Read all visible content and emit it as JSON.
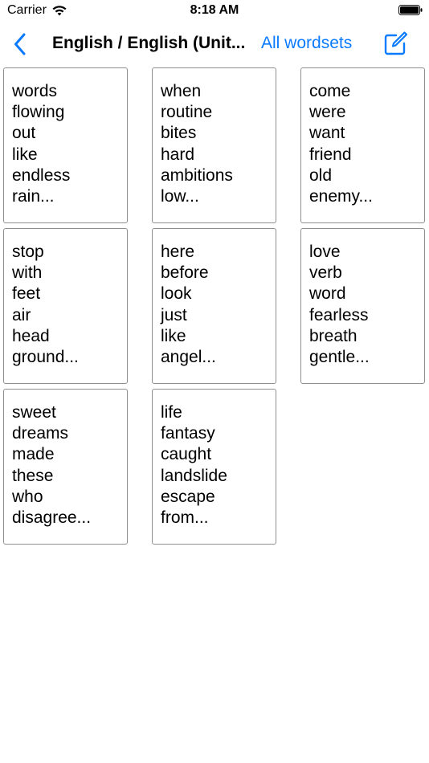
{
  "status_bar": {
    "carrier": "Carrier",
    "time": "8:18 AM"
  },
  "nav": {
    "title": "English / English (Unit...",
    "all_wordsets_label": "All wordsets",
    "accent_color": "#0a7aff"
  },
  "wordsets": [
    {
      "lines": [
        "words",
        "flowing",
        "out",
        "like",
        "endless",
        "rain..."
      ]
    },
    {
      "lines": [
        "when",
        "routine",
        "bites",
        "hard",
        "ambitions",
        "low..."
      ]
    },
    {
      "lines": [
        "come",
        "were",
        "want",
        "friend",
        "old",
        "enemy..."
      ]
    },
    {
      "lines": [
        "stop",
        "with",
        "feet",
        "air",
        "head",
        "ground..."
      ]
    },
    {
      "lines": [
        "here",
        "before",
        "look",
        "just",
        "like",
        "angel..."
      ]
    },
    {
      "lines": [
        "love",
        "verb",
        "word",
        "fearless",
        "breath",
        "gentle..."
      ]
    },
    {
      "lines": [
        "sweet",
        "dreams",
        "made",
        "these",
        "who",
        "disagree..."
      ]
    },
    {
      "lines": [
        "life",
        "fantasy",
        "caught",
        "landslide",
        "escape",
        "from..."
      ]
    }
  ]
}
